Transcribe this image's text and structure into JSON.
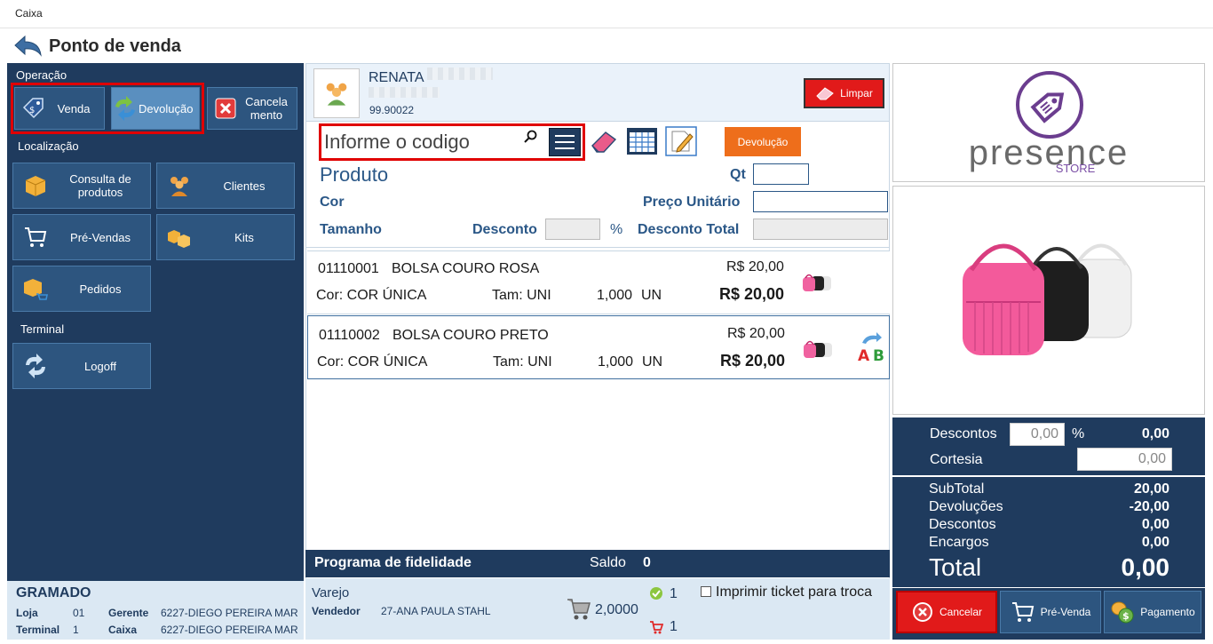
{
  "window": {
    "title": "Caixa"
  },
  "header": {
    "title": "Ponto de venda"
  },
  "left": {
    "operacao_label": "Operação",
    "operacao": [
      {
        "label": "Venda"
      },
      {
        "label": "Devolução"
      },
      {
        "label": "Cancela\nmento"
      }
    ],
    "localizacao_label": "Localização",
    "localizacao": [
      {
        "label": "Consulta de produtos"
      },
      {
        "label": "Clientes"
      },
      {
        "label": "Pré-Vendas"
      },
      {
        "label": "Kits"
      },
      {
        "label": "Pedidos"
      }
    ],
    "terminal_label": "Terminal",
    "terminal": [
      {
        "label": "Logoff"
      }
    ],
    "footer": {
      "city": "GRAMADO",
      "loja_label": "Loja",
      "loja_value": "01",
      "gerente_label": "Gerente",
      "gerente_value": "6227-DIEGO PEREIRA MAR",
      "terminal_label": "Terminal",
      "terminal_value": "1",
      "caixa_label": "Caixa",
      "caixa_value": "6227-DIEGO PEREIRA MAR"
    }
  },
  "customer": {
    "name": "RENATA",
    "code": "99.90022",
    "clear_label": "Limpar"
  },
  "search": {
    "placeholder": "Informe o codigo"
  },
  "devolucao_button": "Devolução",
  "product_form": {
    "produto_label": "Produto",
    "qt_label": "Qt",
    "cor_label": "Cor",
    "preco_label": "Preço Unitário",
    "tamanho_label": "Tamanho",
    "desconto_label": "Desconto",
    "percent": "%",
    "desconto_total_label": "Desconto Total"
  },
  "items": [
    {
      "code": "01110001",
      "name": "BOLSA COURO ROSA",
      "unit_price": "R$ 20,00",
      "cor": "Cor: COR ÚNICA",
      "tam": "Tam: UNI",
      "qty": "1,000",
      "unit": "UN",
      "total": "R$ 20,00"
    },
    {
      "code": "01110002",
      "name": "BOLSA COURO PRETO",
      "unit_price": "R$ 20,00",
      "cor": "Cor: COR ÚNICA",
      "tam": "Tam: UNI",
      "qty": "1,000",
      "unit": "UN",
      "total": "R$ 20,00"
    }
  ],
  "fidelidade": {
    "label": "Programa de fidelidade",
    "saldo_label": "Saldo",
    "saldo_value": "0"
  },
  "mid_footer": {
    "tabela": "Varejo",
    "vendedor_label": "Vendedor",
    "vendedor_value": "27-ANA PAULA STAHL",
    "cart_qty": "2,0000",
    "ok_count": "1",
    "cart_count": "1",
    "ticket_label": "Imprimir ticket para troca"
  },
  "logo": {
    "brand": "presence",
    "sub": "STORE"
  },
  "discounts": {
    "descontos_label": "Descontos",
    "descontos_input": "0,00",
    "percent": "%",
    "descontos_value": "0,00",
    "cortesia_label": "Cortesia",
    "cortesia_input": "0,00"
  },
  "totals": {
    "subtotal_label": "SubTotal",
    "subtotal_value": "20,00",
    "devolucoes_label": "Devoluções",
    "devolucoes_value": "-20,00",
    "descontos_label": "Descontos",
    "descontos_value": "0,00",
    "encargos_label": "Encargos",
    "encargos_value": "0,00",
    "total_label": "Total",
    "total_value": "0,00"
  },
  "actions": {
    "cancelar": "Cancelar",
    "prevenda": "Pré-Venda",
    "pagamento": "Pagamento"
  },
  "colors": {
    "navy": "#1f3b5e",
    "button": "#2d557f",
    "red": "#e00000",
    "orange": "#ee6e1b",
    "brand_purple": "#6b3d8f"
  }
}
